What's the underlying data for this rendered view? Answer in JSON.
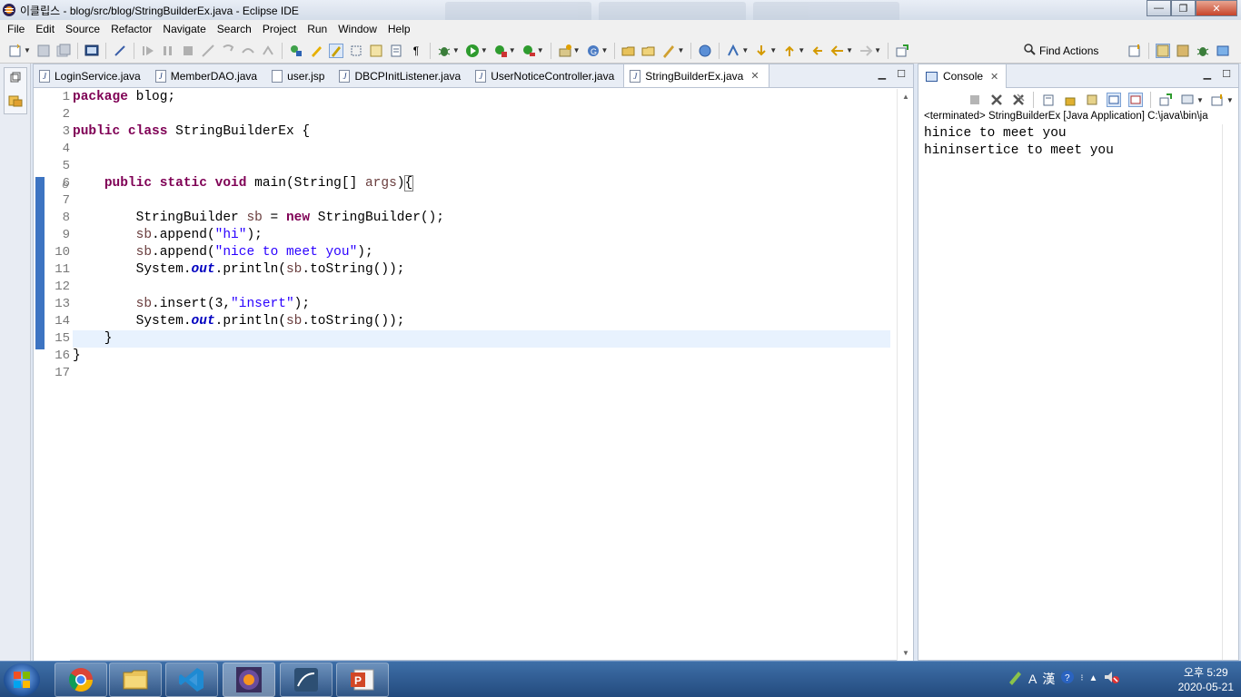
{
  "window": {
    "title": "이클립스 - blog/src/blog/StringBuilderEx.java - Eclipse IDE",
    "minimize": "—",
    "maximize": "❐",
    "close": "✕"
  },
  "menu": [
    "File",
    "Edit",
    "Source",
    "Refactor",
    "Navigate",
    "Search",
    "Project",
    "Run",
    "Window",
    "Help"
  ],
  "toolbar": {
    "find_actions_label": "Find Actions"
  },
  "editor": {
    "tabs": [
      {
        "label": "LoginService.java",
        "active": false
      },
      {
        "label": "MemberDAO.java",
        "active": false
      },
      {
        "label": "user.jsp",
        "active": false
      },
      {
        "label": "DBCPInitListener.java",
        "active": false
      },
      {
        "label": "UserNoticeController.java",
        "active": false
      },
      {
        "label": "StringBuilderEx.java",
        "active": true
      }
    ],
    "line_numbers": [
      "1",
      "2",
      "3",
      "4",
      "5",
      "6",
      "7",
      "8",
      "9",
      "10",
      "11",
      "12",
      "13",
      "14",
      "15",
      "16",
      "17"
    ],
    "code": {
      "l1_kw": "package",
      "l1_rest": " blog;",
      "l3_kw": "public class",
      "l3_rest": " StringBuilderEx {",
      "l6_indent": "    ",
      "l6_kw": "public static void",
      "l6_rest": " main(String[] ",
      "l6_var": "args",
      "l6_close": ")",
      "l6_brace": "{",
      "l8_indent": "        ",
      "l8_a": "StringBuilder ",
      "l8_var": "sb",
      "l8_b": " = ",
      "l8_kw": "new",
      "l8_c": " StringBuilder();",
      "l9_indent": "        ",
      "l9_var": "sb",
      "l9_a": ".append(",
      "l9_str": "\"hi\"",
      "l9_b": ");",
      "l10_indent": "        ",
      "l10_var": "sb",
      "l10_a": ".append(",
      "l10_str": "\"nice to meet you\"",
      "l10_b": ");",
      "l11_indent": "        ",
      "l11_a": "System.",
      "l11_fld": "out",
      "l11_b": ".println(",
      "l11_var": "sb",
      "l11_c": ".toString());",
      "l13_indent": "        ",
      "l13_var": "sb",
      "l13_a": ".insert(3,",
      "l13_str": "\"insert\"",
      "l13_b": ");",
      "l14_indent": "        ",
      "l14_a": "System.",
      "l14_fld": "out",
      "l14_b": ".println(",
      "l14_var": "sb",
      "l14_c": ".toString());",
      "l15": "    }",
      "l16": "}"
    }
  },
  "console": {
    "tab_label": "Console",
    "terminated": "<terminated> StringBuilderEx [Java Application] C:\\java\\bin\\ja",
    "output": [
      "hinice to meet you",
      "hininsertice to meet you"
    ]
  },
  "taskbar": {
    "tray_lang": "A",
    "tray_hanja": "漢",
    "time": "오후 5:29",
    "date": "2020-05-21"
  },
  "colors": {
    "keyword": "#7f0055",
    "string": "#2a00ff",
    "field": "#0000c0",
    "local_var": "#6a3e3e",
    "current_line": "#e8f2fe"
  }
}
